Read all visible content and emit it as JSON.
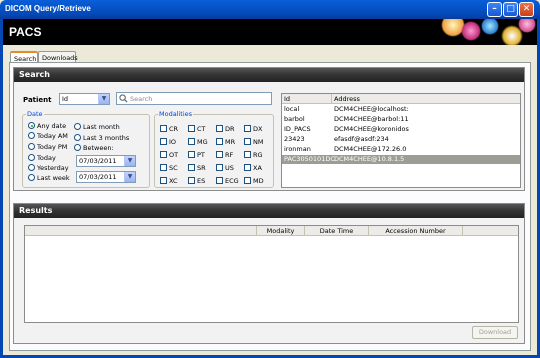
{
  "window": {
    "title": "DICOM Query/Retrieve",
    "controls": [
      "minimize",
      "maximize",
      "close"
    ]
  },
  "banner": {
    "app_name": "PACS"
  },
  "tabs": [
    {
      "label": "Search",
      "active": true
    },
    {
      "label": "Downloads",
      "active": false
    }
  ],
  "search": {
    "section_title": "Search",
    "patient_label": "Patient",
    "patient_field": "Id",
    "search_placeholder": "Search",
    "date": {
      "legend": "Date",
      "options": [
        "Any date",
        "Today AM",
        "Today PM",
        "Today",
        "Yesterday",
        "Last week",
        "Last month",
        "Last 3 months",
        "Between:"
      ],
      "selected": "Any date",
      "from_date": "07/03/2011",
      "to_date": "07/03/2011"
    },
    "modalities": {
      "legend": "Modalities",
      "items": [
        "CR",
        "CT",
        "DR",
        "DX",
        "IO",
        "MG",
        "MR",
        "NM",
        "OT",
        "PT",
        "RF",
        "RG",
        "SC",
        "SR",
        "US",
        "XA",
        "XC",
        "ES",
        "ECG",
        "MD"
      ]
    },
    "servers": {
      "columns": [
        "Id",
        "Address"
      ],
      "rows": [
        {
          "id": "local",
          "address": "DCM4CHEE@localhost:"
        },
        {
          "id": "barbol",
          "address": "DCM4CHEE@barbol:11"
        },
        {
          "id": "ID_PACS",
          "address": "DCM4CHEE@koronidos"
        },
        {
          "id": "23423",
          "address": "efasdf@asdf:234"
        },
        {
          "id": "ironman",
          "address": "DCM4CHEE@172.26.0"
        },
        {
          "id": "PAC3050101DC",
          "address": "DCM4CHEE@10.8.1.5",
          "selected": true
        }
      ]
    }
  },
  "results": {
    "section_title": "Results",
    "columns": [
      "",
      "Modality",
      "Date Time",
      "Accession Number"
    ],
    "download_label": "Download"
  },
  "colors": {
    "titlebar": "#0553c9",
    "section_header": "#333333",
    "legend_text": "#0046d5",
    "selected_row": "#9d9c95"
  }
}
